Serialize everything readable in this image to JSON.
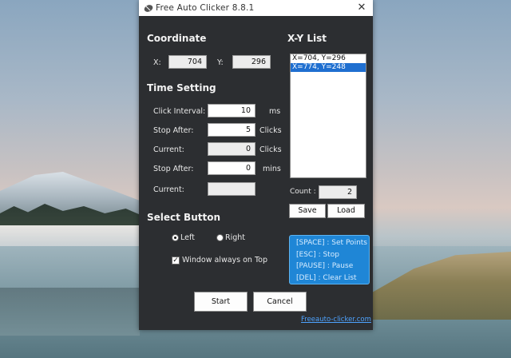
{
  "window": {
    "title": "Free Auto Clicker 8.8.1",
    "close_glyph": "✕"
  },
  "coordinate": {
    "heading": "Coordinate",
    "x_label": "X:",
    "x_value": "704",
    "y_label": "Y:",
    "y_value": "296"
  },
  "time_setting": {
    "heading": "Time Setting",
    "click_interval": {
      "label": "Click Interval:",
      "value": "10",
      "unit": "ms"
    },
    "stop_after_clicks": {
      "label": "Stop After:",
      "value": "5",
      "unit": "Clicks"
    },
    "current_clicks": {
      "label": "Current:",
      "value": "0",
      "unit": "Clicks"
    },
    "stop_after_mins": {
      "label": "Stop After:",
      "value": "0",
      "unit": "mins"
    },
    "current_time": {
      "label": "Current:",
      "value": ""
    }
  },
  "select_button": {
    "heading": "Select Button",
    "left_label": "Left",
    "right_label": "Right",
    "selected": "Left",
    "window_top_label": "Window always on Top",
    "window_top_checked": true
  },
  "xy_list": {
    "heading": "X-Y List",
    "items": [
      "X=704, Y=296",
      "X=774, Y=248"
    ],
    "selected_index": 1,
    "count_label": "Count :",
    "count_value": "2",
    "save_label": "Save",
    "load_label": "Load"
  },
  "hotkeys": [
    "[SPACE] : Set Points",
    "[ESC] : Stop",
    "[PAUSE] : Pause",
    "[DEL] : Clear List"
  ],
  "actions": {
    "start_label": "Start",
    "cancel_label": "Cancel"
  },
  "footer_link": "Freeauto-clicker.com",
  "colors": {
    "window_bg": "#2c2e31",
    "selection": "#1f6fd0",
    "hotkey_panel": "#1f86d6",
    "link": "#4ea3ff"
  }
}
